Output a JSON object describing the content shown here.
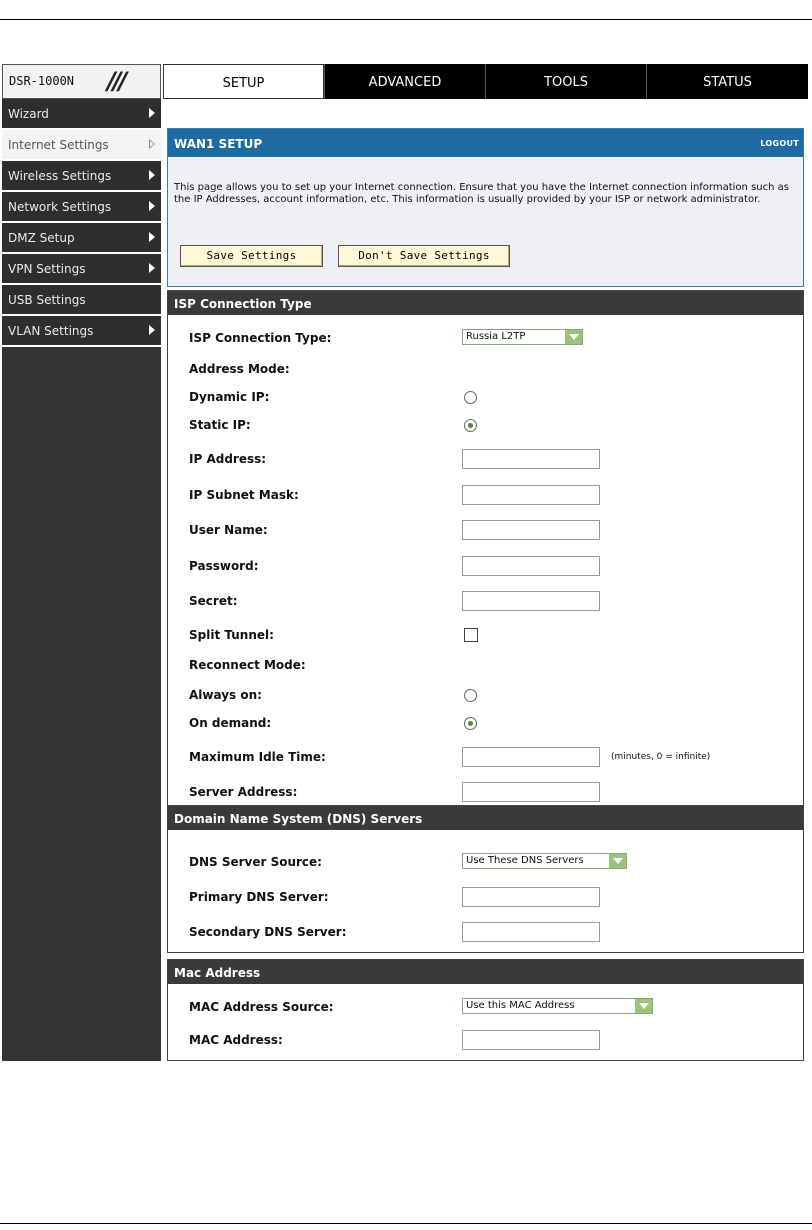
{
  "brand": {
    "model": "DSR-1000N",
    "slashes": "///"
  },
  "tabs": [
    "SETUP",
    "ADVANCED",
    "TOOLS",
    "STATUS"
  ],
  "sidebar": [
    {
      "label": "Wizard",
      "active": false
    },
    {
      "label": "Internet Settings",
      "active": true
    },
    {
      "label": "Wireless Settings",
      "active": false
    },
    {
      "label": "Network Settings",
      "active": false
    },
    {
      "label": "DMZ Setup",
      "active": false
    },
    {
      "label": "VPN Settings",
      "active": false
    },
    {
      "label": "USB Settings",
      "active": false,
      "no_arrow": true
    },
    {
      "label": "VLAN Settings",
      "active": false
    }
  ],
  "wan": {
    "title": "WAN1 SETUP",
    "logout": "LOGOUT",
    "description": "This page allows you to set up your Internet connection. Ensure that you have the Internet connection information such as the IP Addresses, account information, etc. This information is usually provided by your ISP or network administrator.",
    "save_label": "Save Settings",
    "dont_save_label": "Don't Save Settings"
  },
  "isp": {
    "header": "ISP Connection Type",
    "connection_type_label": "ISP Connection Type:",
    "connection_type_value": "Russia L2TP",
    "address_mode_label": "Address Mode:",
    "dynamic_ip_label": "Dynamic IP:",
    "static_ip_label": "Static IP:",
    "address_mode_selected": "static",
    "ip_address_label": "IP Address:",
    "subnet_mask_label": "IP Subnet Mask:",
    "user_name_label": "User Name:",
    "password_label": "Password:",
    "secret_label": "Secret:",
    "split_tunnel_label": "Split Tunnel:",
    "split_tunnel_checked": false,
    "reconnect_mode_label": "Reconnect Mode:",
    "always_on_label": "Always on:",
    "on_demand_label": "On demand:",
    "reconnect_selected": "on_demand",
    "max_idle_label": "Maximum Idle Time:",
    "max_idle_hint": "(minutes, 0 = infinite)",
    "server_address_label": "Server Address:"
  },
  "dns": {
    "header": "Domain Name System (DNS) Servers",
    "source_label": "DNS Server Source:",
    "source_value": "Use These DNS Servers",
    "primary_label": "Primary DNS Server:",
    "secondary_label": "Secondary DNS Server:"
  },
  "mac": {
    "header": "Mac Address",
    "source_label": "MAC Address Source:",
    "source_value": "Use this MAC Address",
    "address_label": "MAC Address:"
  },
  "colors": {
    "header_blue": "#1f6aa0",
    "section_dark": "#3a3a3a",
    "sidebar": "#333333",
    "button_bg": "#fff8d8"
  }
}
